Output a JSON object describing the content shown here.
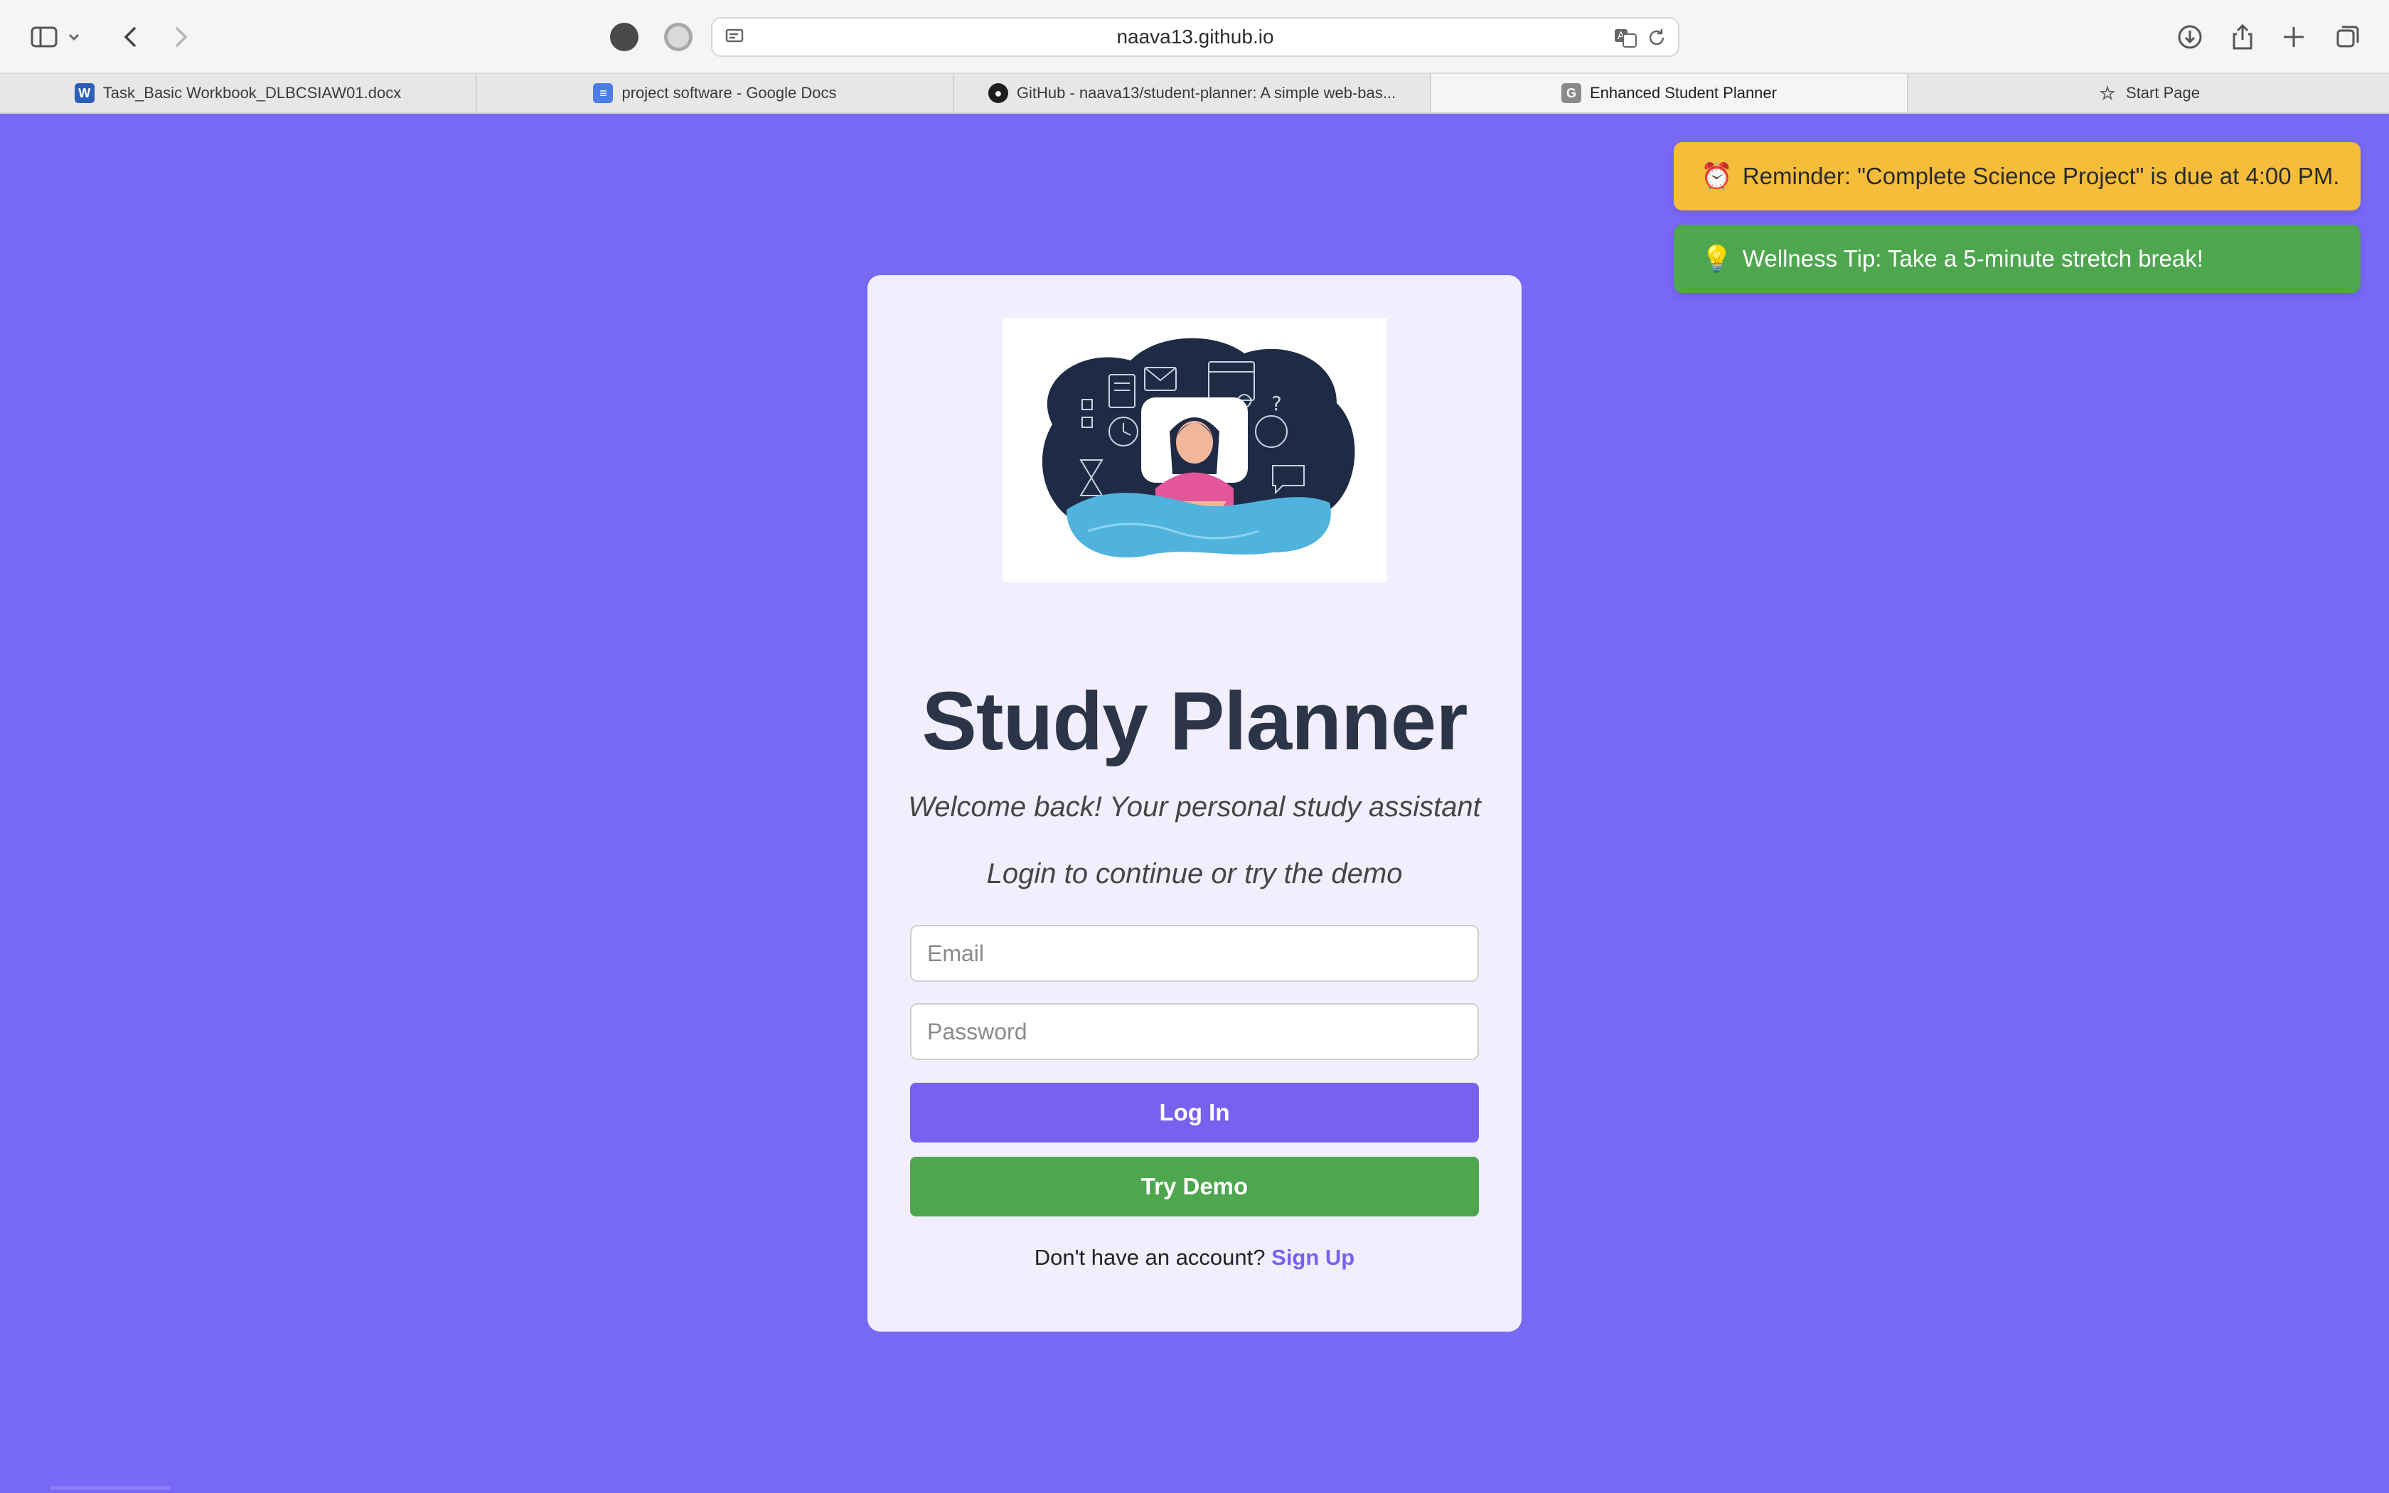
{
  "browser": {
    "url": "naava13.github.io",
    "tabs": [
      {
        "label": "Task_Basic Workbook_DLBCSIAW01.docx",
        "icon": "word-doc-icon",
        "active": false
      },
      {
        "label": "project software - Google Docs",
        "icon": "google-docs-icon",
        "active": false
      },
      {
        "label": "GitHub - naava13/student-planner: A simple web-bas...",
        "icon": "github-icon",
        "active": false
      },
      {
        "label": "Enhanced Student Planner",
        "icon": "site-favicon-icon",
        "active": true
      },
      {
        "label": "Start Page",
        "icon": "star-icon",
        "active": false
      }
    ]
  },
  "notifications": {
    "reminder": {
      "emoji": "⏰",
      "text": "Reminder: \"Complete Science Project\" is due at 4:00 PM.",
      "color": "#f6bd3a"
    },
    "wellness": {
      "emoji": "💡",
      "text": "Wellness Tip: Take a 5-minute stretch break!",
      "color": "#4ea64f"
    }
  },
  "login": {
    "title": "Study Planner",
    "subtitle": "Welcome back! Your personal study assistant",
    "prompt": "Login to continue or try the demo",
    "email_placeholder": "Email",
    "email_value": "",
    "password_placeholder": "Password",
    "password_value": "",
    "login_label": "Log In",
    "demo_label": "Try Demo",
    "signup_text": "Don't have an account?",
    "signup_link": "Sign Up"
  },
  "colors": {
    "background": "#7868f6",
    "card": "#f1effd",
    "primary": "#7662ee",
    "success": "#4ea64f",
    "warning": "#f6bd3a",
    "title": "#2c3547"
  }
}
